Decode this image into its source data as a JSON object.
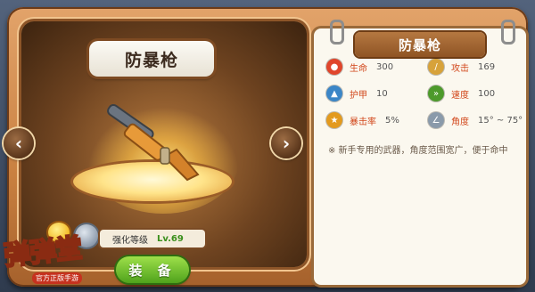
{
  "weapon": {
    "name": "防暴枪",
    "card_title": "防暴枪",
    "enhance_label": "强化等级",
    "enhance_value": "Lv.69",
    "equip_label": "装 备",
    "description": "※ 新手专用的武器，角度范围宽广，便于命中"
  },
  "stats": [
    {
      "label": "生命",
      "value": "300",
      "icon": "life-drop-icon",
      "color": "#e0452b"
    },
    {
      "label": "攻击",
      "value": "169",
      "icon": "attack-pencil-icon",
      "color": "#d7a23a"
    },
    {
      "label": "护甲",
      "value": "10",
      "icon": "armor-icon",
      "color": "#3b86c7"
    },
    {
      "label": "速度",
      "value": "100",
      "icon": "speed-boot-icon",
      "color": "#4d9a2b"
    },
    {
      "label": "暴击率",
      "value": "5%",
      "icon": "crit-star-icon",
      "color": "#e39a1e"
    },
    {
      "label": "角度",
      "value": "15° ~ 75°",
      "icon": "angle-icon",
      "color": "#8a9aaa"
    }
  ],
  "logo": {
    "title": "弹弹堂",
    "subtitle": "官方正版手游"
  },
  "colors": {
    "frame": "#c98040",
    "card_bg": "#fbf8ef",
    "stat_label": "#d2481c",
    "equip_green": "#4fa21c"
  }
}
